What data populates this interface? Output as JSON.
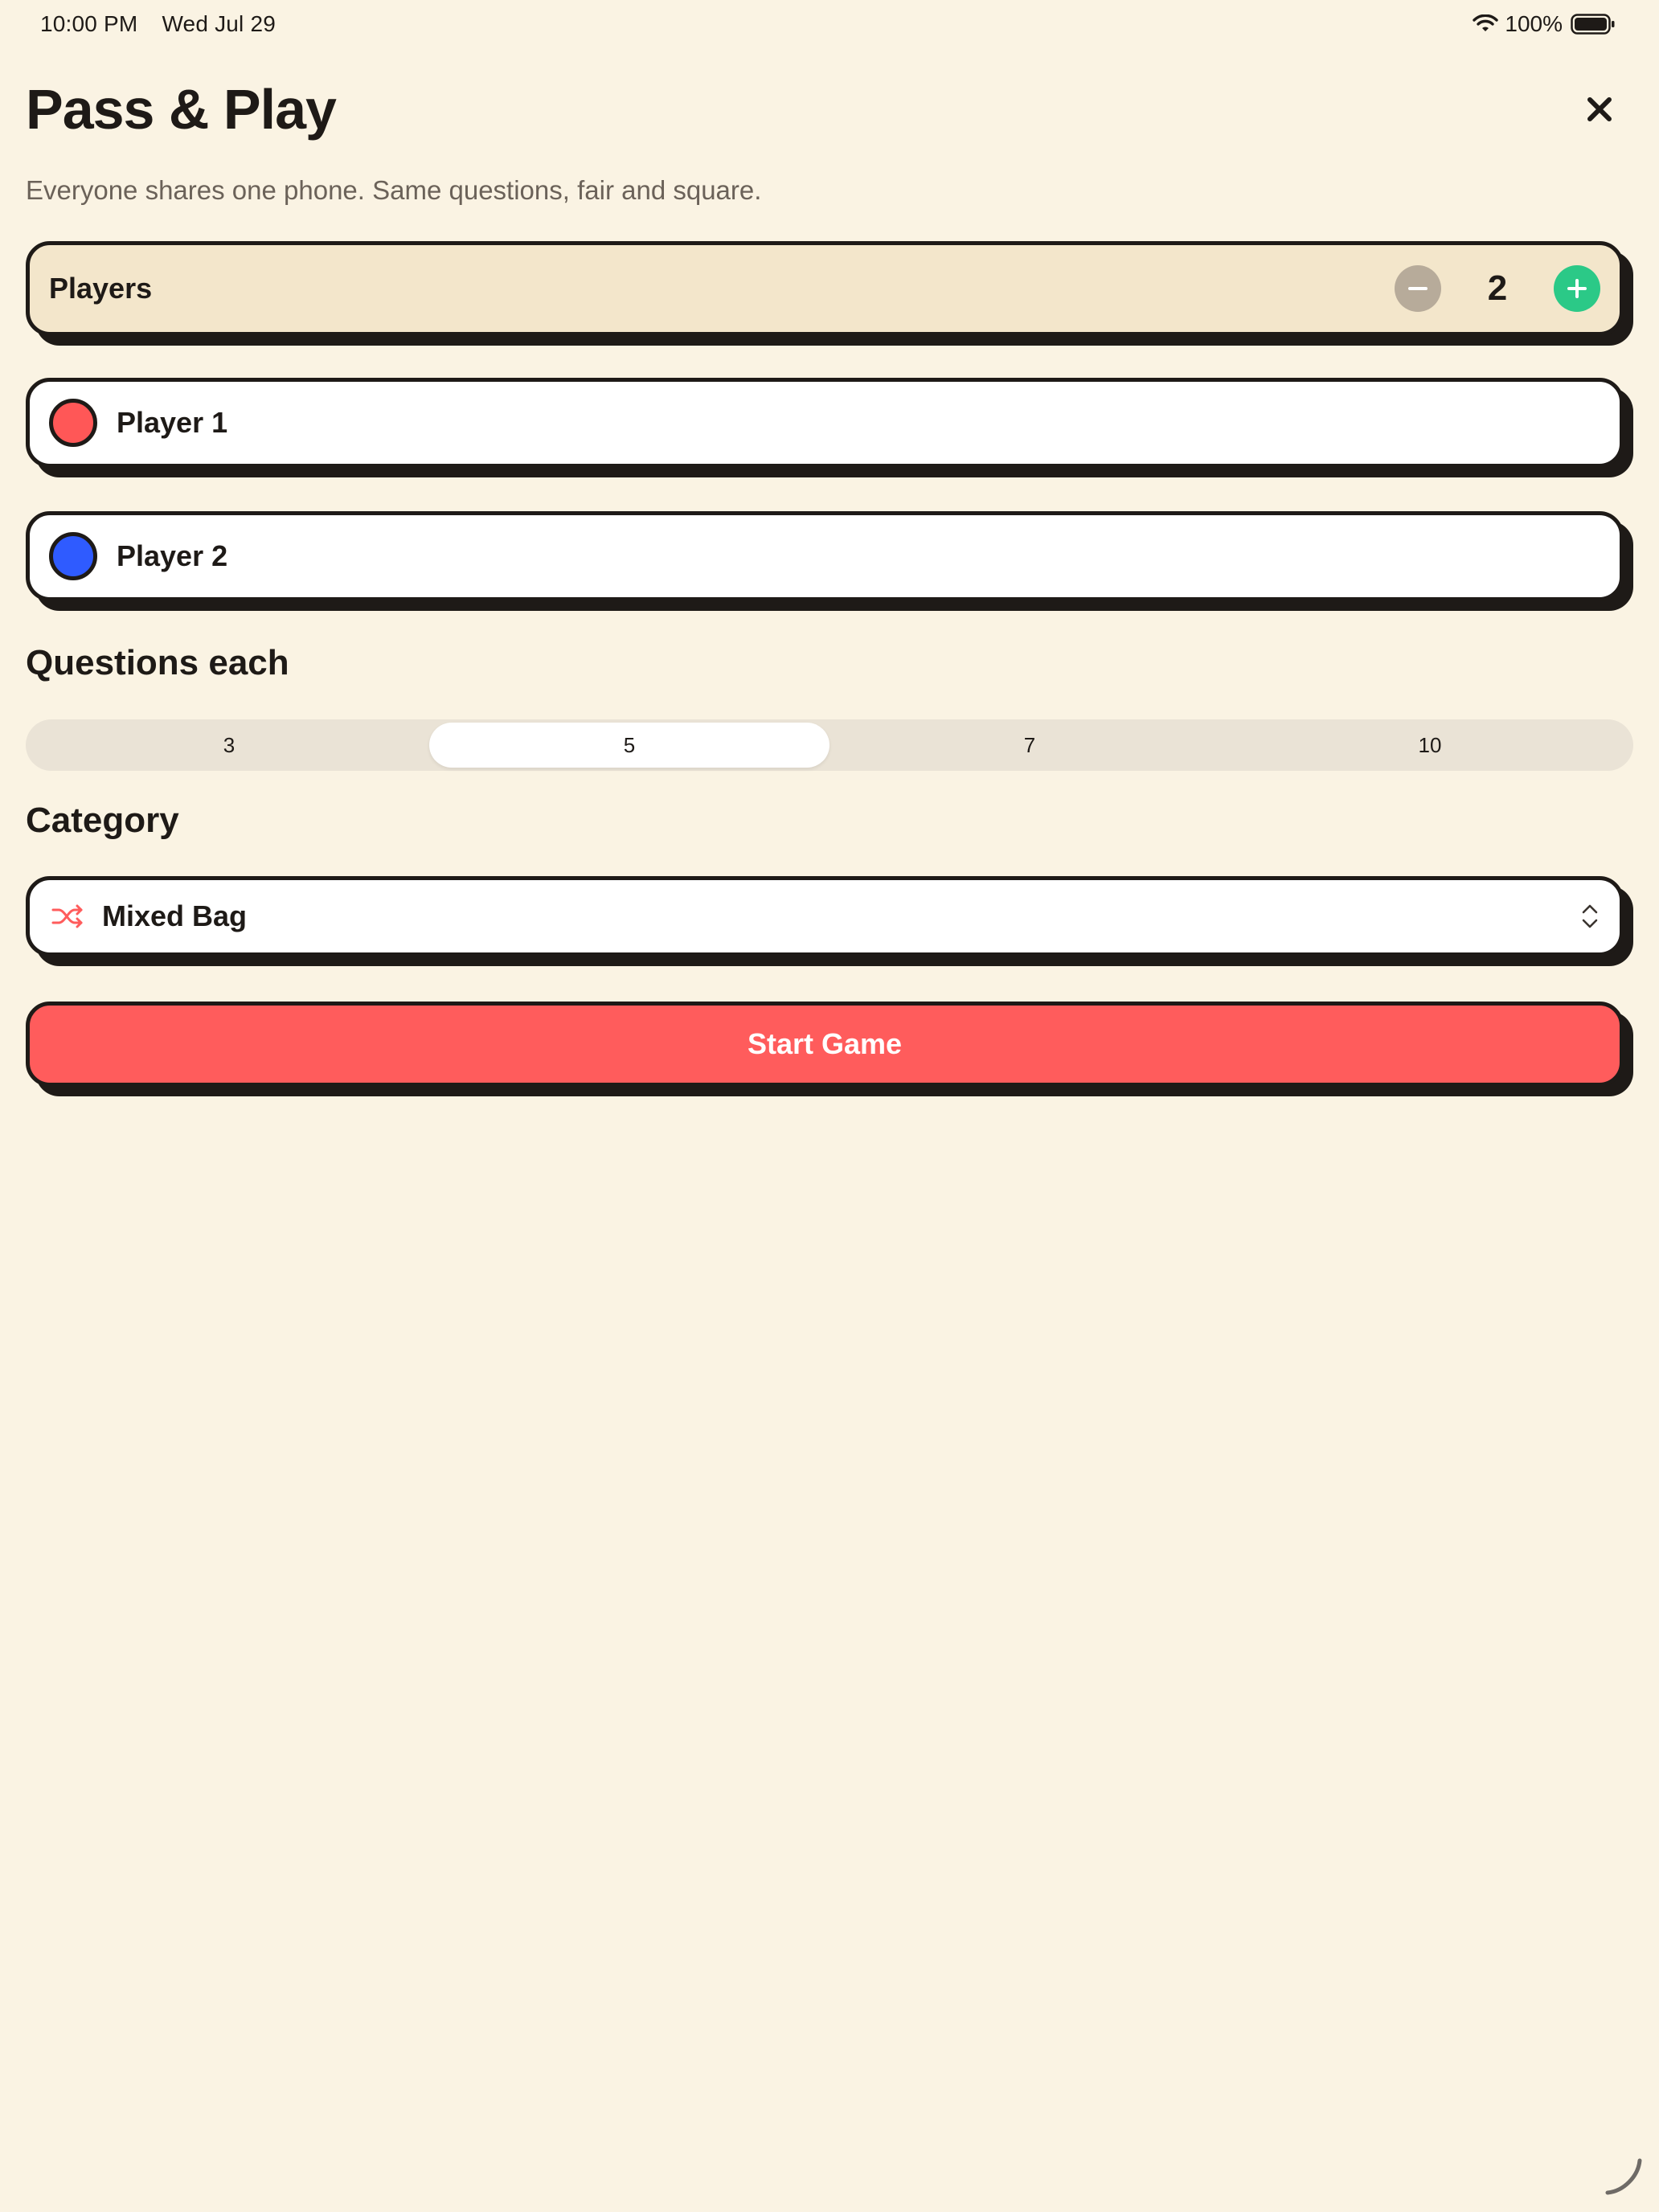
{
  "status_bar": {
    "time": "10:00 PM",
    "date": "Wed Jul 29",
    "battery": "100%",
    "icons": [
      "wifi-icon",
      "battery-icon"
    ]
  },
  "header": {
    "title": "Pass & Play",
    "subtitle": "Everyone shares one phone. Same questions, fair and square.",
    "close_icon": "close-icon"
  },
  "players": {
    "label": "Players",
    "count": "2",
    "decrement_icon": "minus-icon",
    "increment_icon": "plus-icon",
    "list": [
      {
        "name": "Player 1",
        "color": "#FF5757"
      },
      {
        "name": "Player 2",
        "color": "#2F5BFF"
      }
    ]
  },
  "questions": {
    "heading": "Questions each",
    "options": [
      "3",
      "5",
      "7",
      "10"
    ],
    "selected": "5"
  },
  "category": {
    "heading": "Category",
    "value": "Mixed Bag",
    "icon": "shuffle-icon",
    "chevron_icon": "chevron-up-down-icon"
  },
  "actions": {
    "start_label": "Start Game"
  },
  "colors": {
    "background": "#FAF3E3",
    "accent": "#FF5C5C",
    "plus": "#2BC987",
    "minus_disabled": "#B7AB9A",
    "ink": "#1E1A17"
  }
}
